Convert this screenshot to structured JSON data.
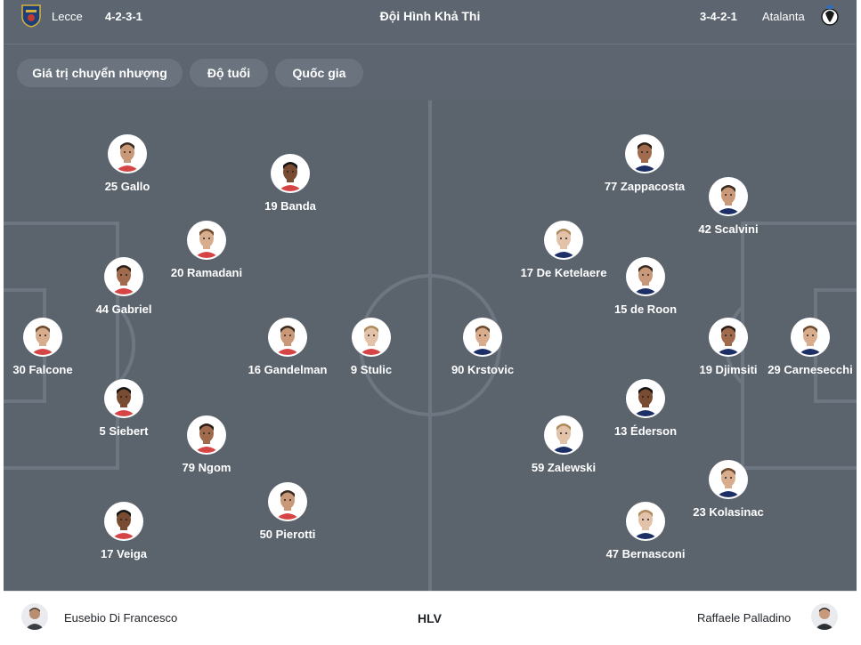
{
  "header": {
    "home_team": "Lecce",
    "home_formation": "4-2-3-1",
    "title": "Đội Hình Khả Thi",
    "away_formation": "3-4-2-1",
    "away_team": "Atalanta"
  },
  "filters": [
    "Giá trị chuyển nhượng",
    "Độ tuổi",
    "Quốc gia"
  ],
  "home_players": [
    {
      "label": "25 Gallo"
    },
    {
      "label": "19 Banda"
    },
    {
      "label": "20 Ramadani"
    },
    {
      "label": "44 Gabriel"
    },
    {
      "label": "30 Falcone"
    },
    {
      "label": "16 Gandelman"
    },
    {
      "label": "9 Stulic"
    },
    {
      "label": "5 Siebert"
    },
    {
      "label": "79 Ngom"
    },
    {
      "label": "50 Pierotti"
    },
    {
      "label": "17 Veiga"
    }
  ],
  "away_players": [
    {
      "label": "77 Zappacosta"
    },
    {
      "label": "42 Scalvini"
    },
    {
      "label": "17 De Ketelaere"
    },
    {
      "label": "15 de Roon"
    },
    {
      "label": "90 Krstovic"
    },
    {
      "label": "19 Djimsiti"
    },
    {
      "label": "29 Carnesecchi"
    },
    {
      "label": "13 Éderson"
    },
    {
      "label": "59 Zalewski"
    },
    {
      "label": "23 Kolasinac"
    },
    {
      "label": "47 Bernasconi"
    }
  ],
  "coaches": {
    "home": "Eusebio Di Francesco",
    "label": "HLV",
    "away": "Raffaele Palladino"
  },
  "colors": {
    "pitch": "#5b636d",
    "header": "#5d6670",
    "chip": "#6b747e",
    "lines": "#6e7781"
  }
}
